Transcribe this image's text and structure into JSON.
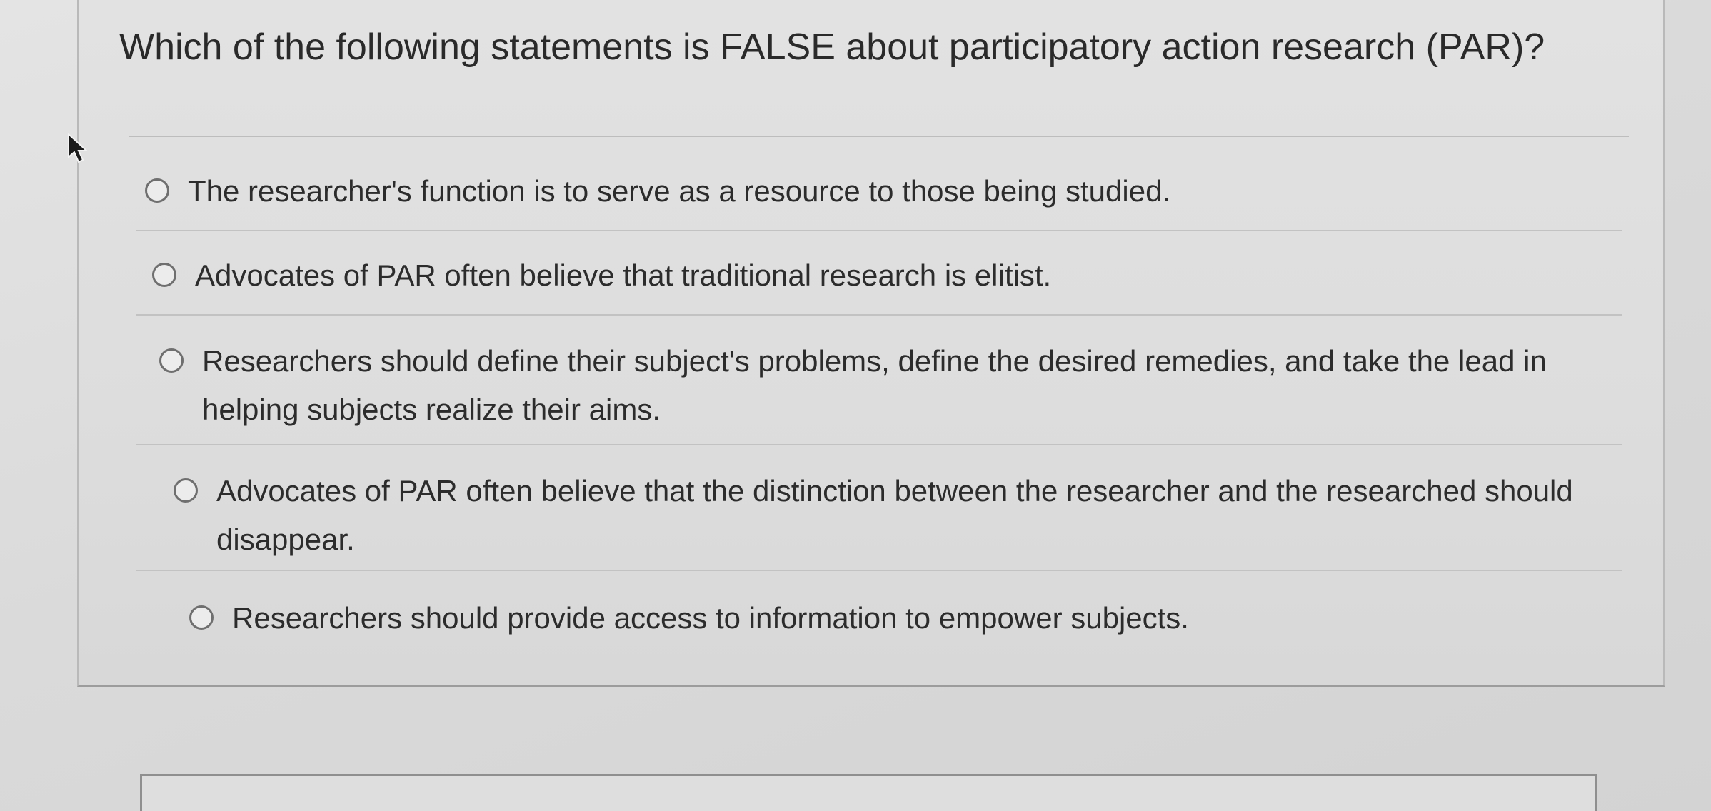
{
  "question": {
    "text": "Which of the following statements is FALSE about participatory action research (PAR)?"
  },
  "answers": [
    {
      "label": "The researcher's function is to serve as a resource to those being studied.",
      "selected": false
    },
    {
      "label": "Advocates of PAR often believe that traditional research is elitist.",
      "selected": false
    },
    {
      "label": "Researchers should define their subject's problems, define the desired remedies, and take the lead in helping subjects realize their aims.",
      "selected": false
    },
    {
      "label": "Advocates of PAR often believe that the distinction between the researcher and the researched should disappear.",
      "selected": false
    },
    {
      "label": "Researchers should provide access to information to empower subjects.",
      "selected": false
    }
  ],
  "icons": {
    "cursor": "mouse-pointer-icon",
    "radio": "radio-button-icon"
  },
  "colors": {
    "text": "#2a2a2a",
    "radio_border": "#6f6f6f",
    "divider": "#c2c2c2"
  }
}
